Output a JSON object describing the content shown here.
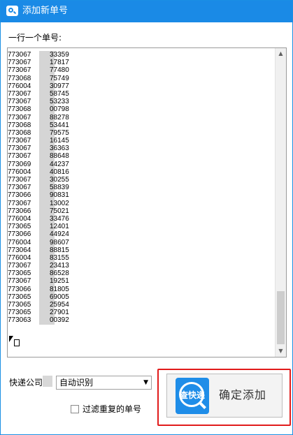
{
  "window": {
    "title": "添加新单号"
  },
  "form": {
    "instruction_label": "一行一个单号:",
    "tracking_numbers": [
      {
        "prefix": "773067",
        "suffix": "33359"
      },
      {
        "prefix": "773067",
        "suffix": "17817"
      },
      {
        "prefix": "773067",
        "suffix": "77480"
      },
      {
        "prefix": "773068",
        "suffix": "75749"
      },
      {
        "prefix": "776004",
        "suffix": "30977"
      },
      {
        "prefix": "773067",
        "suffix": "58745"
      },
      {
        "prefix": "773067",
        "suffix": "53233"
      },
      {
        "prefix": "773068",
        "suffix": "00798"
      },
      {
        "prefix": "773067",
        "suffix": "88278"
      },
      {
        "prefix": "773068",
        "suffix": "53441"
      },
      {
        "prefix": "773068",
        "suffix": "79575"
      },
      {
        "prefix": "773067",
        "suffix": "16145"
      },
      {
        "prefix": "773067",
        "suffix": "36363"
      },
      {
        "prefix": "773067",
        "suffix": "88648"
      },
      {
        "prefix": "773069",
        "suffix": "44237"
      },
      {
        "prefix": "776004",
        "suffix": "40816"
      },
      {
        "prefix": "773067",
        "suffix": "30255"
      },
      {
        "prefix": "773067",
        "suffix": "58839"
      },
      {
        "prefix": "773066",
        "suffix": "90831"
      },
      {
        "prefix": "773067",
        "suffix": "13002"
      },
      {
        "prefix": "773066",
        "suffix": "75021"
      },
      {
        "prefix": "776004",
        "suffix": "33476"
      },
      {
        "prefix": "773065",
        "suffix": "12401"
      },
      {
        "prefix": "773066",
        "suffix": "44924"
      },
      {
        "prefix": "776004",
        "suffix": "98607"
      },
      {
        "prefix": "773064",
        "suffix": "88815"
      },
      {
        "prefix": "776004",
        "suffix": "83155"
      },
      {
        "prefix": "773067",
        "suffix": "23413"
      },
      {
        "prefix": "773065",
        "suffix": "86528"
      },
      {
        "prefix": "773067",
        "suffix": "19251"
      },
      {
        "prefix": "773066",
        "suffix": "81805"
      },
      {
        "prefix": "773065",
        "suffix": "69005"
      },
      {
        "prefix": "773065",
        "suffix": "25954"
      },
      {
        "prefix": "773065",
        "suffix": "27901"
      },
      {
        "prefix": "773063",
        "suffix": "00392"
      }
    ],
    "courier_label": "快递公司:",
    "courier_select_value": "自动识别",
    "dedupe_checkbox_label": "过滤重复的单号",
    "dedupe_checked": false
  },
  "add_button": {
    "logo_text": "查快递",
    "label": "确定添加"
  },
  "colors": {
    "titlebar": "#1a8ae6",
    "highlight": "#e11b1b",
    "logo": "#1f8de8"
  },
  "icons": {
    "app": "magnifier-icon",
    "cursor": "pointer-with-document-icon",
    "select_arrow": "triangle-down-icon",
    "scroll_up": "triangle-up-icon",
    "scroll_down": "triangle-down-icon"
  }
}
